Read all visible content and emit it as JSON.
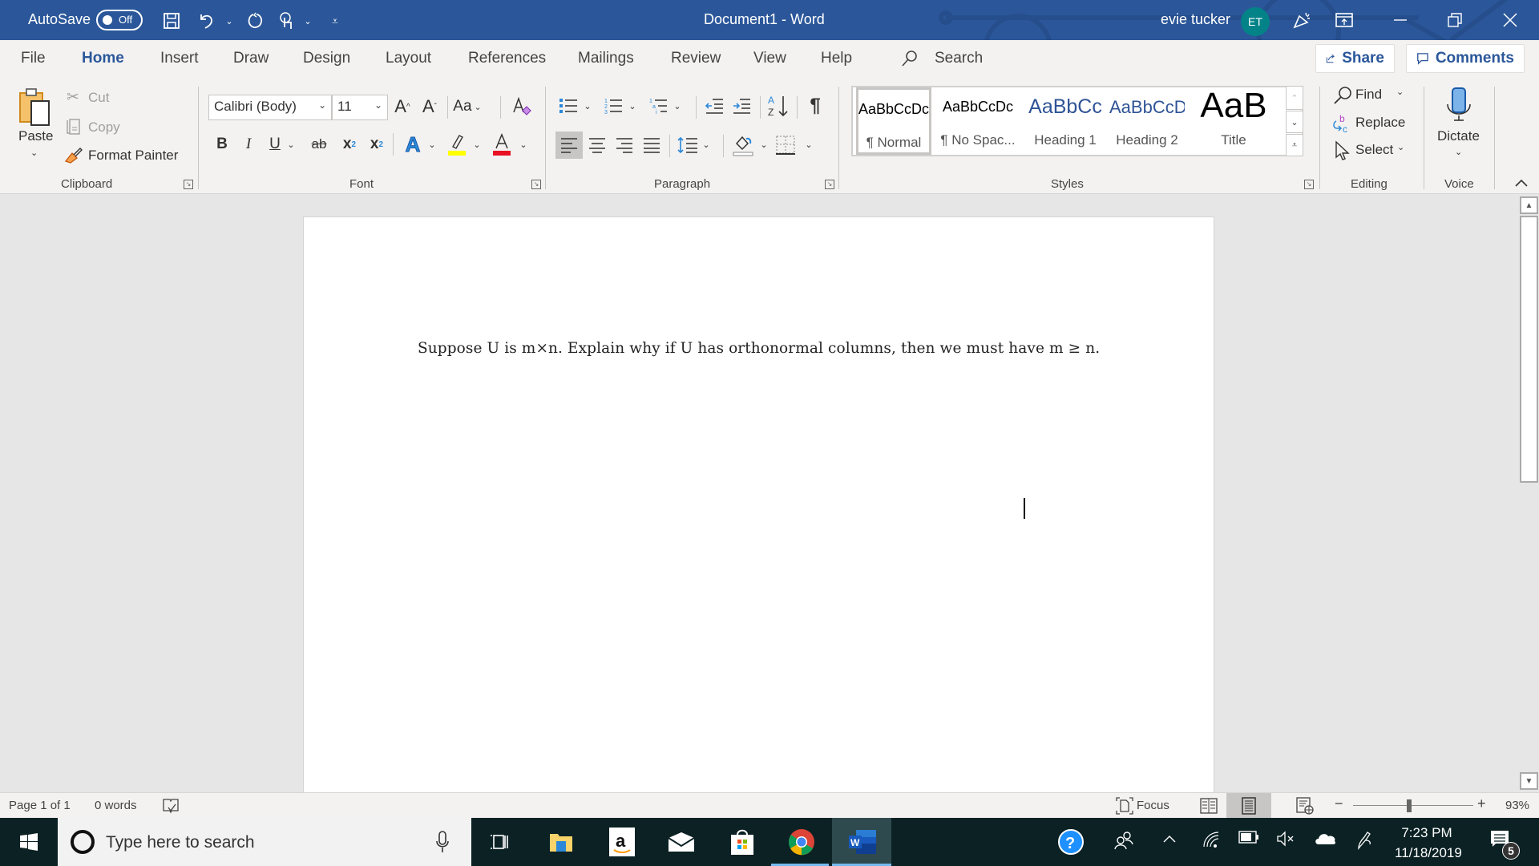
{
  "titlebar": {
    "autosave_label": "AutoSave",
    "autosave_state": "Off",
    "document_title": "Document1  -  Word",
    "user_name": "evie tucker",
    "user_initials": "ET",
    "qat_icons": [
      "save-icon",
      "undo-icon",
      "redo-icon",
      "touch-mode-icon",
      "customize-qat-icon"
    ],
    "window_controls": [
      "ribbon-display-options-icon",
      "minimize-icon",
      "restore-icon",
      "close-icon"
    ],
    "colors": {
      "brand": "#2b579a",
      "avatar": "#038387"
    }
  },
  "tabs": {
    "items": [
      "File",
      "Home",
      "Insert",
      "Draw",
      "Design",
      "Layout",
      "References",
      "Mailings",
      "Review",
      "View",
      "Help"
    ],
    "active": "Home",
    "search_label": "Search",
    "share_label": "Share",
    "comments_label": "Comments"
  },
  "ribbon": {
    "clipboard": {
      "label": "Clipboard",
      "paste": "Paste",
      "cut": "Cut",
      "copy": "Copy",
      "format_painter": "Format Painter"
    },
    "font": {
      "label": "Font",
      "font_name": "Calibri (Body)",
      "font_size": "11",
      "change_case": "Aa",
      "bold": "B",
      "italic": "I",
      "underline": "U",
      "strikethrough": "ab",
      "subscript": "x",
      "superscript": "x",
      "highlight_color": "#ffff00",
      "font_color": "#e81123"
    },
    "paragraph": {
      "label": "Paragraph"
    },
    "styles": {
      "label": "Styles",
      "items": [
        {
          "preview": "AaBbCcDc",
          "name": "¶ Normal",
          "selected": true
        },
        {
          "preview": "AaBbCcDc",
          "name": "¶ No Spac..."
        },
        {
          "preview": "AaBbCc",
          "name": "Heading 1"
        },
        {
          "preview": "AaBbCcD",
          "name": "Heading 2"
        },
        {
          "preview": "AaB",
          "name": "Title"
        }
      ]
    },
    "editing": {
      "label": "Editing",
      "find": "Find",
      "replace": "Replace",
      "select": "Select"
    },
    "voice": {
      "label": "Voice",
      "dictate": "Dictate"
    }
  },
  "document": {
    "text": "Suppose U is m×n. Explain why if U has orthonormal columns, then we must have m ≥ n."
  },
  "statusbar": {
    "page": "Page 1 of 1",
    "words": "0 words",
    "focus": "Focus",
    "zoom_percent": "93%",
    "zoom_value": 93
  },
  "taskbar": {
    "search_placeholder": "Type here to search",
    "apps": [
      "task-view-icon",
      "file-explorer-icon",
      "amazon-icon",
      "mail-icon",
      "store-icon",
      "chrome-icon",
      "word-icon"
    ],
    "time": "7:23 PM",
    "date": "11/18/2019",
    "notification_count": "5"
  }
}
